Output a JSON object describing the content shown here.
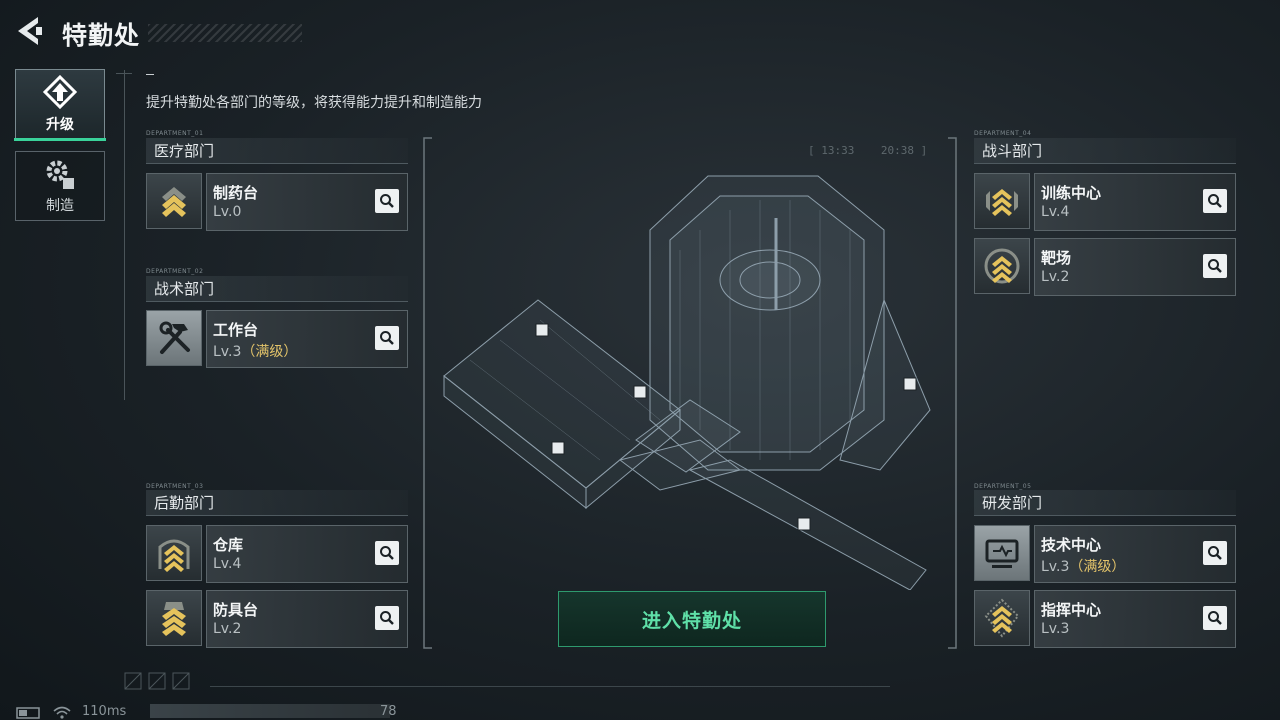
{
  "header": {
    "title": "特勤处"
  },
  "nav": {
    "upgrade_label": "升级",
    "craft_label": "制造",
    "accent": "#3ad29a"
  },
  "subtitle": "提升特勤处各部门的等级，将获得能力提升和制造能力",
  "departments": {
    "medical": {
      "caption": "DEPARTMENT_01",
      "title": "医疗部门",
      "cards": [
        {
          "name": "制药台",
          "level": "Lv.0",
          "max": ""
        }
      ]
    },
    "tactical": {
      "caption": "DEPARTMENT_02",
      "title": "战术部门",
      "cards": [
        {
          "name": "工作台",
          "level": "Lv.3",
          "max": "（满级）"
        }
      ]
    },
    "logistics": {
      "caption": "DEPARTMENT_03",
      "title": "后勤部门",
      "cards": [
        {
          "name": "仓库",
          "level": "Lv.4",
          "max": ""
        },
        {
          "name": "防具台",
          "level": "Lv.2",
          "max": ""
        }
      ]
    },
    "combat": {
      "caption": "DEPARTMENT_04",
      "title": "战斗部门",
      "cards": [
        {
          "name": "训练中心",
          "level": "Lv.4",
          "max": ""
        },
        {
          "name": "靶场",
          "level": "Lv.2",
          "max": ""
        }
      ]
    },
    "research": {
      "caption": "DEPARTMENT_05",
      "title": "研发部门",
      "cards": [
        {
          "name": "技术中心",
          "level": "Lv.3",
          "max": "（满级）"
        },
        {
          "name": "指挥中心",
          "level": "Lv.3",
          "max": ""
        }
      ]
    }
  },
  "center": {
    "enter_label": "进入特勤处",
    "hud_time_a": "13:33",
    "hud_time_b": "20:38"
  },
  "status": {
    "ping": "110ms",
    "number": "78"
  },
  "colors": {
    "max_level": "#e2c36a",
    "enter_text": "#5fe0a8"
  }
}
